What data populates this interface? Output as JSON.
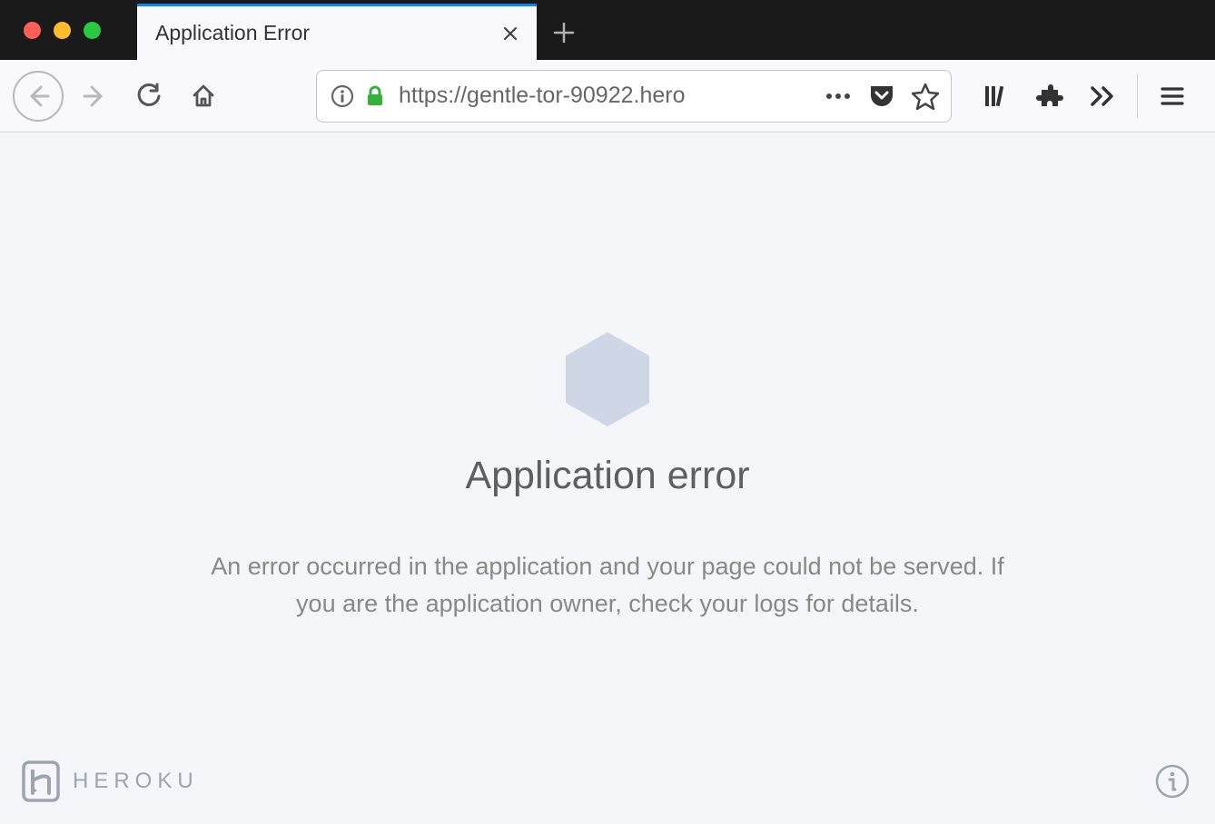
{
  "window": {
    "tab_title": "Application Error"
  },
  "address_bar": {
    "url_display": "https://gentle-tor-90922.hero"
  },
  "page": {
    "title": "Application error",
    "description": "An error occurred in the application and your page could not be served. If you are the application owner, check your logs for details."
  },
  "footer": {
    "brand": "HEROKU"
  }
}
